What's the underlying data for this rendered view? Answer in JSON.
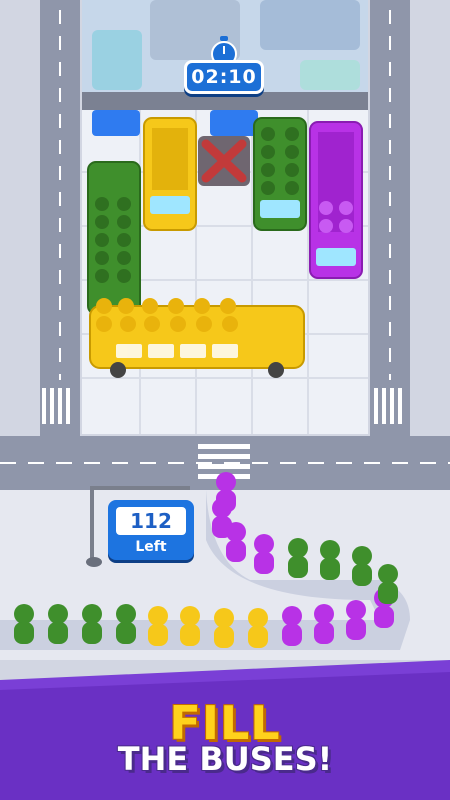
{
  "timer": {
    "time": "02:10"
  },
  "stop_sign": {
    "count": "112",
    "label": "Left"
  },
  "banner": {
    "line1": "FILL",
    "line2": "THE BUSES!"
  },
  "colors": {
    "green": "#3f8f2c",
    "yellow": "#f6c81a",
    "purple": "#b832e6",
    "blue": "#2f7bf0",
    "accent_banner": "#7a3fd6"
  },
  "icons": [
    "stopwatch-icon",
    "blocked-x-icon",
    "bus-stop-sign"
  ]
}
